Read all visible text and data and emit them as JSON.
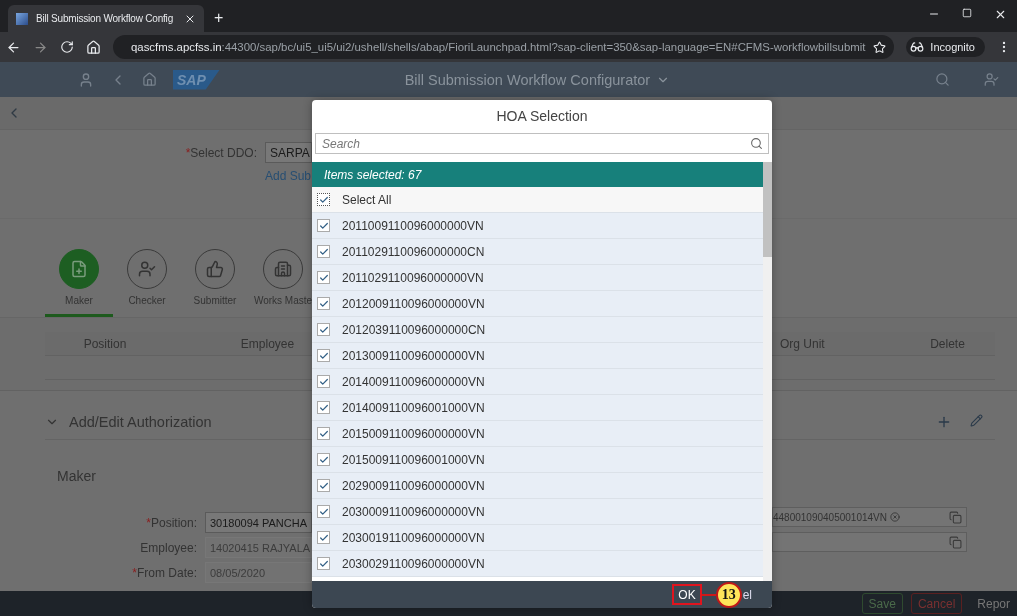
{
  "browser": {
    "tab_title": "Bill Submission Workflow Config",
    "new_tab": "+",
    "url_host": "qascfms.apcfss.in",
    "url_path": ":44300/sap/bc/ui5_ui5/ui2/ushell/shells/abap/FioriLaunchpad.html?sap-client=350&sap-language=EN#CFMS-workflowbillsubmit",
    "profile": "Incognito"
  },
  "shell": {
    "title": "Bill Submission Workflow Configurator",
    "logo": "SAP"
  },
  "required_mark": "*",
  "ddo": {
    "label": "Select DDO:",
    "required": true,
    "value": "SARPA",
    "link": "Add Sub"
  },
  "role_tabs": [
    {
      "label": "Maker",
      "selected": true
    },
    {
      "label": "Checker",
      "selected": false
    },
    {
      "label": "Submitter",
      "selected": false
    },
    {
      "label": "Works Maste",
      "selected": false
    }
  ],
  "table": {
    "columns": [
      "Position",
      "Employee",
      "Org Unit",
      "Delete"
    ]
  },
  "authorization": {
    "title": "Add/Edit Authorization",
    "expanded": true,
    "role": "Maker",
    "hoa_token": "448001090405001014VN",
    "fields": [
      {
        "label": "Position:",
        "required": true,
        "value": "30180094 PANCHA",
        "disabled": false
      },
      {
        "label": "Employee:",
        "required": false,
        "value": "14020415 RAJYALA",
        "disabled": true
      },
      {
        "label": "From Date:",
        "required": true,
        "value": "08/05/2020",
        "disabled": true
      }
    ]
  },
  "dialog": {
    "title": "HOA Selection",
    "search": {
      "placeholder": "Search"
    },
    "info": "Items selected: 67",
    "select_all": {
      "label": "Select All",
      "checked": true
    },
    "items": [
      {
        "label": "2011009110096000000VN",
        "checked": true
      },
      {
        "label": "2011029110096000000CN",
        "checked": true
      },
      {
        "label": "2011029110096000000VN",
        "checked": true
      },
      {
        "label": "2012009110096000000VN",
        "checked": true
      },
      {
        "label": "2012039110096000000CN",
        "checked": true
      },
      {
        "label": "2013009110096000000VN",
        "checked": true
      },
      {
        "label": "2014009110096000000VN",
        "checked": true
      },
      {
        "label": "2014009110096001000VN",
        "checked": true
      },
      {
        "label": "2015009110096000000VN",
        "checked": true
      },
      {
        "label": "2015009110096001000VN",
        "checked": true
      },
      {
        "label": "2029009110096000000VN",
        "checked": true
      },
      {
        "label": "2030009110096000000VN",
        "checked": true
      },
      {
        "label": "2030019110096000000VN",
        "checked": true
      },
      {
        "label": "2030029110096000000VN",
        "checked": true
      }
    ],
    "ok": "OK",
    "annotation": "13",
    "cancel": "el"
  },
  "footer": {
    "buttons": [
      {
        "label": "Save",
        "kind": "accept"
      },
      {
        "label": "Cancel",
        "kind": "reject"
      },
      {
        "label": "Repor",
        "kind": "plain"
      }
    ]
  }
}
